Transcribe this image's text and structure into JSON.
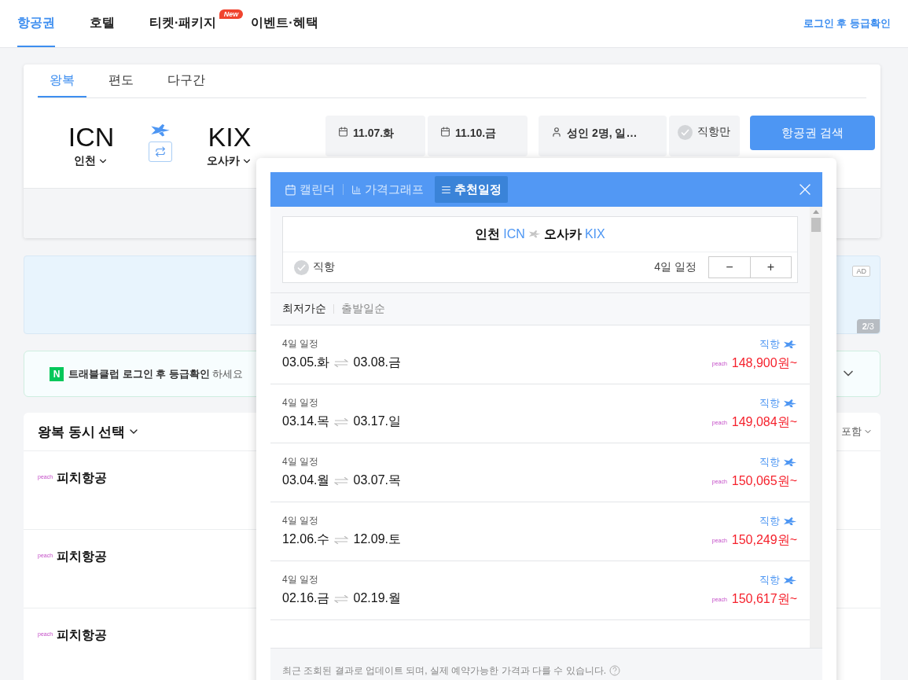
{
  "nav": {
    "tabs": [
      {
        "label": "항공권",
        "selected": true
      },
      {
        "label": "호텔",
        "selected": false
      },
      {
        "label": "티켓·패키지",
        "selected": false,
        "badge": "New"
      },
      {
        "label": "이벤트·혜택",
        "selected": false
      }
    ],
    "login_link": "로그인 후 등급확인"
  },
  "search": {
    "trip_tabs": [
      {
        "label": "왕복",
        "selected": true
      },
      {
        "label": "편도",
        "selected": false
      },
      {
        "label": "다구간",
        "selected": false
      }
    ],
    "origin": {
      "code": "ICN",
      "city": "인천"
    },
    "destination": {
      "code": "KIX",
      "city": "오사카"
    },
    "departure_date": "11.07.화",
    "return_date": "11.10.금",
    "passengers": "성인 2명, 일…",
    "direct_only": {
      "label": "직항만",
      "checked": false
    },
    "search_button": "항공권 검색"
  },
  "ad": {
    "badge": "AD",
    "pager": "**2**/3"
  },
  "login_banner": {
    "logo": "N",
    "text": "**트래블클럽 로그인 후 등급확인** 하세요"
  },
  "results": {
    "title": "왕복 동시 선택",
    "filter": "포함",
    "airlines": [
      {
        "logo": "peach",
        "name": "피치항공"
      },
      {
        "logo": "peach",
        "name": "피치항공"
      },
      {
        "logo": "peach",
        "name": "피치항공"
      }
    ]
  },
  "popup": {
    "tabs": [
      {
        "label": "캘린더",
        "kind": "calendar",
        "selected": false
      },
      {
        "label": "가격그래프",
        "kind": "graph",
        "selected": false
      },
      {
        "label": "추천일정",
        "kind": "list",
        "selected": true
      }
    ],
    "route": {
      "origin_city": "인천",
      "origin_code": "ICN",
      "destination_city": "오사카",
      "destination_code": "KIX"
    },
    "direct": {
      "label": "직항",
      "checked": false
    },
    "duration": "4일 일정",
    "stepper": [
      "−",
      "+"
    ],
    "sort": [
      {
        "label": "최저가순",
        "selected": true
      },
      {
        "label": "출발일순",
        "selected": false
      }
    ],
    "items": [
      {
        "duration": "4일 일정",
        "depart": "03.05.화",
        "return": "03.08.금",
        "direct": "직항",
        "airline": "peach",
        "price": "148,900원~"
      },
      {
        "duration": "4일 일정",
        "depart": "03.14.목",
        "return": "03.17.일",
        "direct": "직항",
        "airline": "peach",
        "price": "149,084원~"
      },
      {
        "duration": "4일 일정",
        "depart": "03.04.월",
        "return": "03.07.목",
        "direct": "직항",
        "airline": "peach",
        "price": "150,065원~"
      },
      {
        "duration": "4일 일정",
        "depart": "12.06.수",
        "return": "12.09.토",
        "direct": "직항",
        "airline": "peach",
        "price": "150,249원~"
      },
      {
        "duration": "4일 일정",
        "depart": "02.16.금",
        "return": "02.19.월",
        "direct": "직항",
        "airline": "peach",
        "price": "150,617원~"
      }
    ],
    "note": "최근 조회된 결과로 업데이트 되며, 실제 예약가능한 가격과 다를 수 있습니다."
  }
}
